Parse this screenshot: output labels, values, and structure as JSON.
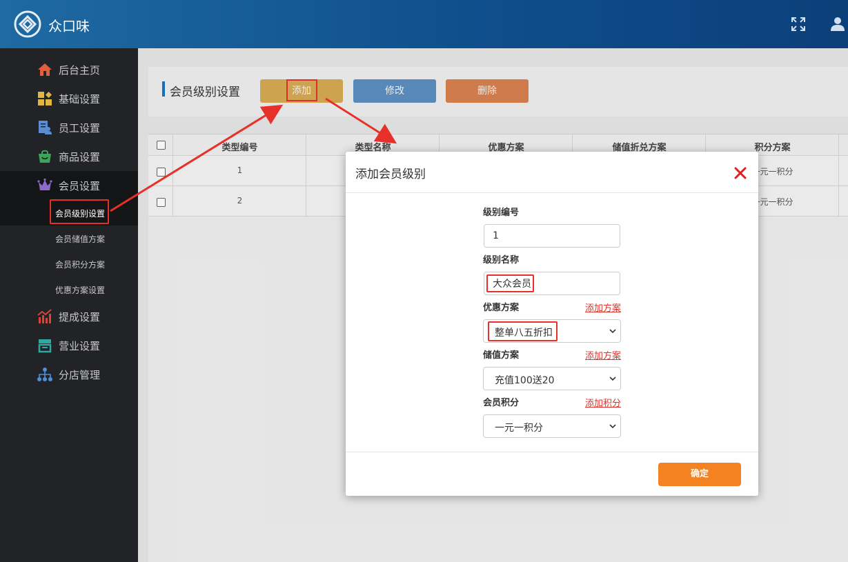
{
  "header": {
    "app_title": "众口味"
  },
  "sidebar": {
    "items": [
      {
        "label": "后台主页",
        "icon": "home-icon"
      },
      {
        "label": "基础设置",
        "icon": "grid-settings-icon"
      },
      {
        "label": "员工设置",
        "icon": "staff-icon"
      },
      {
        "label": "商品设置",
        "icon": "shopping-bag-icon"
      },
      {
        "label": "会员设置",
        "icon": "crown-icon"
      },
      {
        "label": "提成设置",
        "icon": "chart-icon"
      },
      {
        "label": "营业设置",
        "icon": "store-icon"
      },
      {
        "label": "分店管理",
        "icon": "branch-icon"
      }
    ],
    "member_sub": [
      "会员级别设置",
      "会员储值方案",
      "会员积分方案",
      "优惠方案设置"
    ]
  },
  "toolbar": {
    "page_title": "会员级别设置",
    "add": "添加",
    "edit": "修改",
    "delete": "删除"
  },
  "table": {
    "headers": [
      "类型编号",
      "类型名称",
      "优惠方案",
      "储值折兑方案",
      "积分方案"
    ],
    "rows": [
      {
        "id": "1",
        "points": "一元一积分"
      },
      {
        "id": "2",
        "points": "一元一积分"
      }
    ]
  },
  "modal": {
    "title": "添加会员级别",
    "level_no_label": "级别编号",
    "level_no_value": "1",
    "level_name_label": "级别名称",
    "level_name_value": "大众会员",
    "discount_label": "优惠方案",
    "discount_link": "添加方案",
    "discount_value": "整单八五折扣",
    "storage_label": "储值方案",
    "storage_link": "添加方案",
    "storage_value": "充值100送20",
    "points_label": "会员积分",
    "points_link": "添加积分",
    "points_value": "一元一积分",
    "confirm": "确定"
  },
  "colors": {
    "header": "#1f6aa3",
    "sidebar": "#222326",
    "accent": "#f58220",
    "annotation": "#e8302a"
  }
}
